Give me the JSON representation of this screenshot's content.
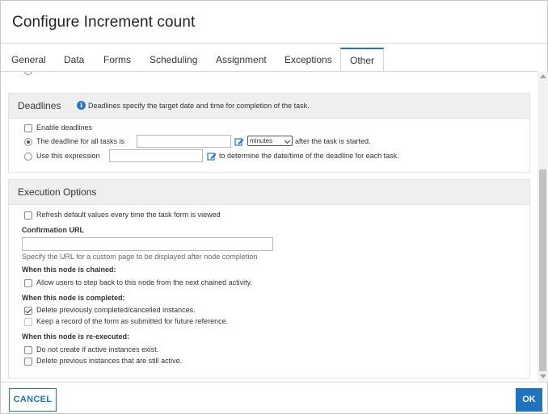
{
  "dialog": {
    "title": "Configure Increment count"
  },
  "tabs": [
    {
      "label": "General"
    },
    {
      "label": "Data"
    },
    {
      "label": "Forms"
    },
    {
      "label": "Scheduling"
    },
    {
      "label": "Assignment"
    },
    {
      "label": "Exceptions"
    },
    {
      "label": "Other",
      "active": true
    }
  ],
  "deadlines": {
    "title": "Deadlines",
    "info": "Deadlines specify the target date and time for completion of the task.",
    "enable_label": "Enable deadlines",
    "enable_checked": false,
    "fixed_label": "The deadline for all tasks is",
    "fixed_selected": true,
    "fixed_value": "",
    "unit_selected": "minutes",
    "after_text": "after the task is started.",
    "expr_label": "Use this expression",
    "expr_value": "",
    "expr_after_text": "to determine the date/time of the deadline for each task."
  },
  "execution": {
    "title": "Execution Options",
    "refresh_label": "Refresh default values every time the task form is viewed",
    "refresh_checked": false,
    "confirmation_url_label": "Confirmation URL",
    "confirmation_url_value": "",
    "confirmation_url_hint": "Specify the URL for a custom page to be displayed after node completion",
    "chained_heading": "When this node is chained:",
    "chained_allow_back_label": "Allow users to step back to this node from the next chained activity.",
    "chained_allow_back_checked": false,
    "completed_heading": "When this node is completed:",
    "completed_delete_label": "Delete previously completed/cancelled instances.",
    "completed_delete_checked": true,
    "completed_keep_label": "Keep a record of the form as submitted for future reference.",
    "completed_keep_checked": false,
    "reexec_heading": "When this node is re-executed:",
    "reexec_no_create_label": "Do not create if active instances exist.",
    "reexec_no_create_checked": false,
    "reexec_delete_label": "Delete previous instances that are still active.",
    "reexec_delete_checked": false
  },
  "footer": {
    "cancel_label": "CANCEL",
    "ok_label": "OK"
  },
  "colors": {
    "accent": "#1e73be",
    "panel_header": "#efefef"
  }
}
